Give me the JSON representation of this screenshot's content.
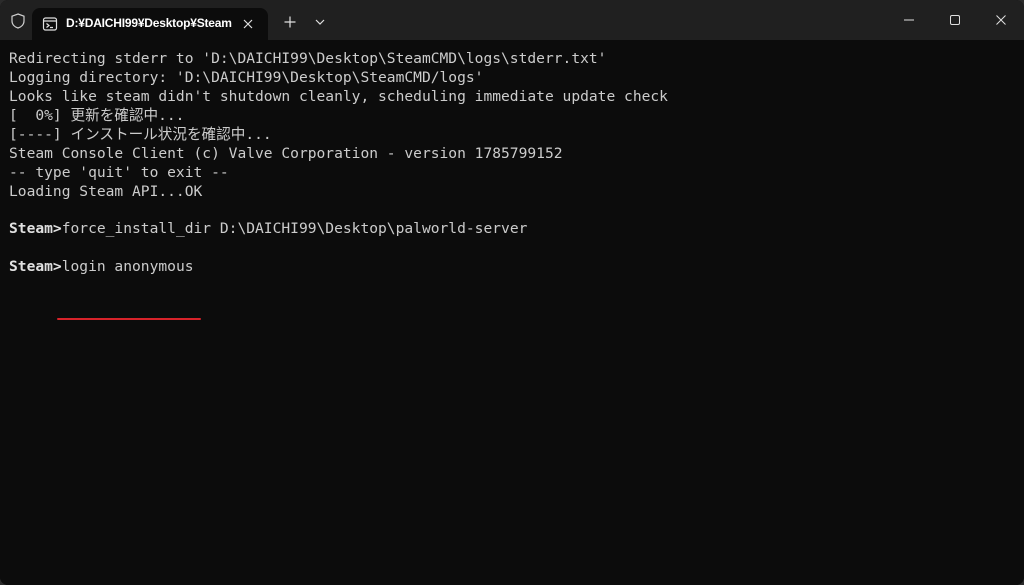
{
  "window": {
    "tab_title": "D:¥DAICHI99¥Desktop¥Steam",
    "icons": {
      "shield": "shield-icon",
      "tab": "terminal-icon",
      "tab_close": "close-icon",
      "new_tab": "plus-icon",
      "dropdown": "chevron-down-icon",
      "minimize": "minimize-icon",
      "maximize": "maximize-icon",
      "close": "close-icon"
    }
  },
  "terminal": {
    "lines": [
      "Redirecting stderr to 'D:\\DAICHI99\\Desktop\\SteamCMD\\logs\\stderr.txt'",
      "Logging directory: 'D:\\DAICHI99\\Desktop\\SteamCMD/logs'",
      "Looks like steam didn't shutdown cleanly, scheduling immediate update check",
      "[  0%] 更新を確認中...",
      "[----] インストール状況を確認中...",
      "Steam Console Client (c) Valve Corporation - version 1785799152",
      "-- type 'quit' to exit --",
      "Loading Steam API...OK"
    ],
    "command1": {
      "prompt": "Steam>",
      "text": "force_install_dir D:\\DAICHI99\\Desktop\\palworld-server"
    },
    "command2": {
      "prompt": "Steam>",
      "text": "login anonymous"
    },
    "highlight_color": "#d8232a"
  }
}
